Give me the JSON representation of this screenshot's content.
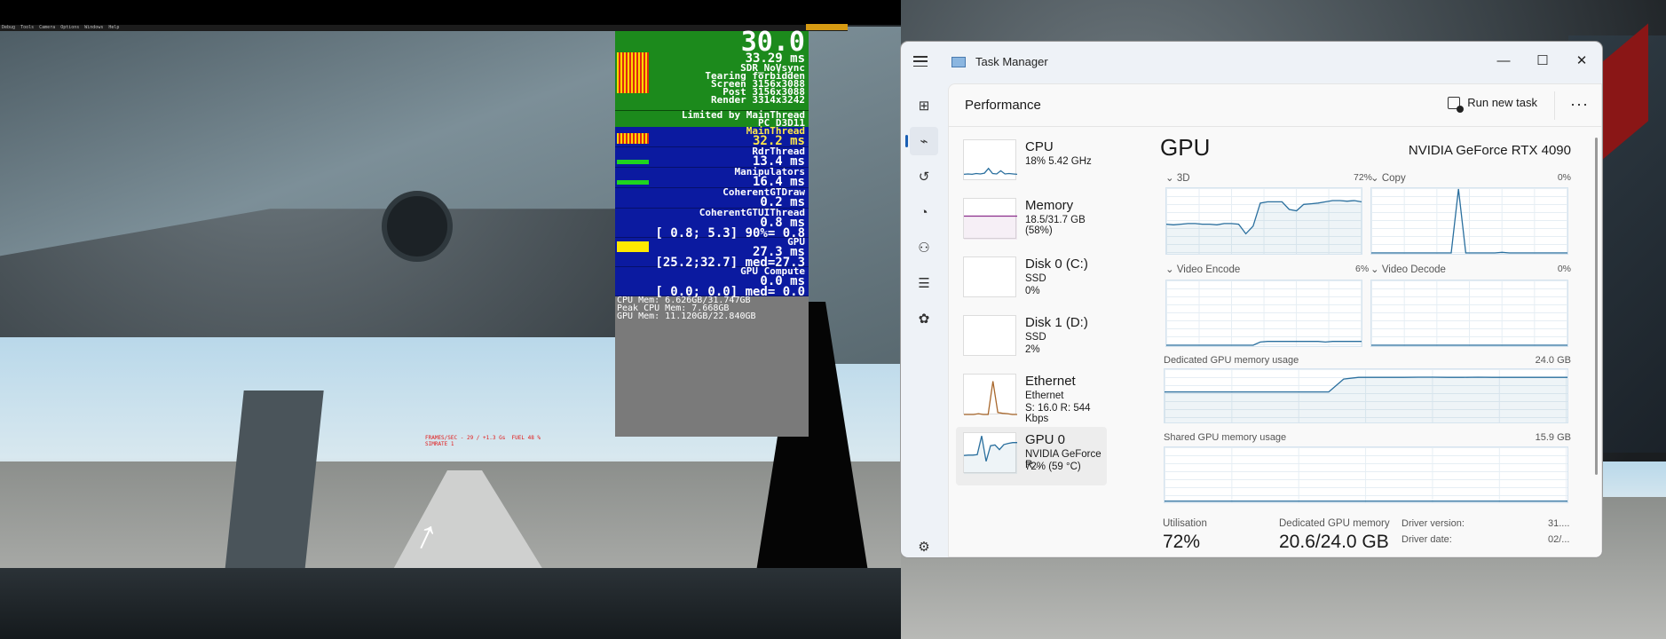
{
  "sim": {
    "menubar": [
      "Debug",
      "Tools",
      "Camera",
      "Options",
      "Windows",
      "Help"
    ],
    "overlay": {
      "fps": "30.0",
      "frame_time": "33.29 ms",
      "lines": [
        "SDR_NoVsync",
        "Tearing forbidden",
        "Screen 3156x3088",
        "Post 3156x3088",
        "Render 3314x3242"
      ],
      "limited_by": "Limited by MainThread",
      "api": "PC D3D11",
      "threads": [
        {
          "name": "MainThread",
          "value": "32.2 ms",
          "highlight": true
        },
        {
          "name": "RdrThread",
          "value": "13.4 ms"
        },
        {
          "name": "Manipulators",
          "value": "16.4 ms"
        },
        {
          "name": "CoherentGTDraw",
          "value": "0.2 ms"
        },
        {
          "name": "CoherentGTUIThread",
          "value": "0.8 ms",
          "range": "[ 0.8; 5.3] 90%= 0.8"
        },
        {
          "name": "GPU",
          "value": "27.3 ms",
          "range": "[25.2;32.7] med=27.3",
          "highlight": true
        },
        {
          "name": "GPU Compute",
          "value": "0.0 ms",
          "range": "[ 0.0; 0.0] med= 0.0"
        }
      ],
      "mem": [
        "CPU Mem: 6.626GB/31.747GB",
        "Peak CPU Mem: 7.668GB",
        "GPU Mem: 11.120GB/22.840GB"
      ]
    },
    "debug_text": [
      "FRAMES/SEC - 29 / +1.3 Gs  FUEL 48 %",
      "SIMRATE 1"
    ]
  },
  "taskmanager": {
    "title": "Task Manager",
    "window_buttons": {
      "minimize": "—",
      "maximize": "☐",
      "close": "✕"
    },
    "page_title": "Performance",
    "run_new_task": "Run new task",
    "more": "···",
    "nav_icons": [
      "processes-icon",
      "performance-icon",
      "app-history-icon",
      "startup-apps-icon",
      "users-icon",
      "details-icon",
      "services-icon",
      "settings-icon"
    ],
    "resources": [
      {
        "name": "CPU",
        "line1": "18%  5.42 GHz",
        "line2": ""
      },
      {
        "name": "Memory",
        "line1": "18.5/31.7 GB (58%)",
        "line2": ""
      },
      {
        "name": "Disk 0 (C:)",
        "line1": "SSD",
        "line2": "0%"
      },
      {
        "name": "Disk 1 (D:)",
        "line1": "SSD",
        "line2": "2%"
      },
      {
        "name": "Ethernet",
        "line1": "Ethernet",
        "line2": "S: 16.0  R: 544 Kbps"
      },
      {
        "name": "GPU 0",
        "line1": "NVIDIA GeForce R...",
        "line2": "72%  (59 °C)",
        "selected": true
      }
    ],
    "gpu": {
      "title": "GPU",
      "model": "NVIDIA GeForce RTX 4090",
      "engines": [
        {
          "label": "3D",
          "value": "72%"
        },
        {
          "label": "Copy",
          "value": "0%"
        },
        {
          "label": "Video Encode",
          "value": "6%"
        },
        {
          "label": "Video Decode",
          "value": "0%"
        }
      ],
      "dedicated_label": "Dedicated GPU memory usage",
      "dedicated_max": "24.0 GB",
      "shared_label": "Shared GPU memory usage",
      "shared_max": "15.9 GB",
      "stats": {
        "utilisation_label": "Utilisation",
        "utilisation": "72%",
        "dedicated_label": "Dedicated GPU memory",
        "dedicated": "20.6/24.0 GB",
        "driver_version_label": "Driver version:",
        "driver_version": "31....",
        "driver_date_label": "Driver date:",
        "driver_date": "02/..."
      }
    },
    "chart_data": [
      {
        "type": "line",
        "title": "3D",
        "ylim": [
          0,
          100
        ],
        "values": [
          45,
          44,
          45,
          46,
          46,
          45,
          45,
          44,
          46,
          46,
          45,
          30,
          42,
          78,
          80,
          80,
          80,
          68,
          66,
          76,
          77,
          78,
          80,
          82,
          82,
          81,
          82,
          80
        ]
      },
      {
        "type": "line",
        "title": "Copy",
        "ylim": [
          0,
          100
        ],
        "values": [
          0,
          0,
          0,
          0,
          0,
          0,
          0,
          0,
          0,
          0,
          0,
          0,
          100,
          0,
          0,
          0,
          0,
          0,
          1,
          0,
          0,
          0,
          0,
          0,
          0,
          0,
          0,
          0
        ]
      },
      {
        "type": "line",
        "title": "Video Encode",
        "ylim": [
          0,
          100
        ],
        "values": [
          0,
          0,
          0,
          0,
          0,
          0,
          0,
          0,
          0,
          0,
          0,
          0,
          0,
          5,
          6,
          6,
          6,
          6,
          6,
          6,
          6,
          6,
          5,
          6,
          6,
          6,
          6,
          6
        ]
      },
      {
        "type": "line",
        "title": "Video Decode",
        "ylim": [
          0,
          100
        ],
        "values": [
          0,
          0,
          0,
          0,
          0,
          0,
          0,
          0,
          0,
          0,
          0,
          0,
          0,
          0,
          0,
          0,
          0,
          0,
          0,
          0,
          0,
          0,
          0,
          0,
          0,
          0,
          0,
          0
        ]
      },
      {
        "type": "area",
        "title": "Dedicated GPU memory usage",
        "ylim": [
          0,
          24
        ],
        "values": [
          13.8,
          13.8,
          13.8,
          13.8,
          13.8,
          13.8,
          13.8,
          13.8,
          13.8,
          13.8,
          13.8,
          13.8,
          19.8,
          20.6,
          20.6,
          20.6,
          20.6,
          20.7,
          20.7,
          20.6,
          20.6,
          20.7,
          20.6,
          20.6,
          20.6,
          20.6,
          20.6,
          20.6
        ]
      },
      {
        "type": "area",
        "title": "Shared GPU memory usage",
        "ylim": [
          0,
          15.9
        ],
        "values": [
          0.1,
          0.1,
          0.1,
          0.1,
          0.1,
          0.1,
          0.1,
          0.1,
          0.1,
          0.1,
          0.1,
          0.1,
          0.1,
          0.1,
          0.1,
          0.1,
          0.1,
          0.1,
          0.1,
          0.1,
          0.1,
          0.1,
          0.1,
          0.1,
          0.1,
          0.1,
          0.1,
          0.1
        ]
      },
      {
        "type": "line",
        "title": "CPU thumbnail",
        "ylim": [
          0,
          100
        ],
        "values": [
          15,
          16,
          15,
          17,
          16,
          18,
          30,
          17,
          16,
          24,
          16,
          17,
          16,
          15
        ]
      },
      {
        "type": "line",
        "title": "Memory thumbnail",
        "ylim": [
          0,
          100
        ],
        "values": [
          58,
          58,
          58,
          58,
          58,
          58,
          58,
          58,
          58,
          58
        ]
      },
      {
        "type": "line",
        "title": "Ethernet thumbnail",
        "ylim": [
          0,
          100
        ],
        "values": [
          0,
          0,
          0,
          2,
          0,
          0,
          85,
          5,
          3,
          2,
          0,
          0
        ]
      },
      {
        "type": "line",
        "title": "GPU 0 thumbnail",
        "ylim": [
          0,
          100
        ],
        "values": [
          45,
          46,
          46,
          47,
          95,
          30,
          70,
          72,
          60,
          73,
          76,
          78,
          78
        ]
      }
    ],
    "colors": {
      "accent": "#1a5fb4",
      "gpu_line": "#2a6f9e",
      "memory_line": "#8b2f8b",
      "ethernet_line": "#a8672c"
    }
  }
}
